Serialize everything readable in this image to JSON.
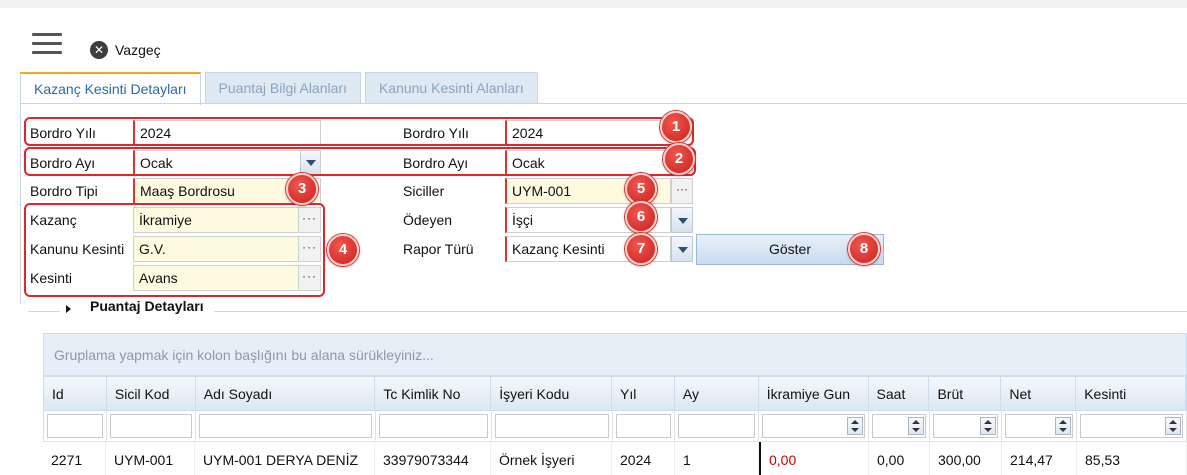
{
  "toolbar": {
    "close_label": "Vazgeç",
    "menu_icon": "hamburger-menu-icon",
    "close_icon": "close-circle-icon"
  },
  "tabs": [
    {
      "label": "Kazanç Kesinti Detayları",
      "active": true
    },
    {
      "label": "Puantaj Bilgi Alanları",
      "active": false
    },
    {
      "label": "Kanunu Kesinti Alanları",
      "active": false
    }
  ],
  "form": {
    "left": {
      "bordro_yili": {
        "label": "Bordro Yılı",
        "value": "2024"
      },
      "bordro_ayi": {
        "label": "Bordro Ayı",
        "value": "Ocak"
      },
      "bordro_tipi": {
        "label": "Bordro Tipi",
        "value": "Maaş Bordrosu"
      },
      "kazanc": {
        "label": "Kazanç",
        "value": "İkramiye"
      },
      "kanunu_kesinti": {
        "label": "Kanunu Kesinti",
        "value": "G.V."
      },
      "kesinti": {
        "label": "Kesinti",
        "value": "Avans"
      }
    },
    "right": {
      "bordro_yili": {
        "label": "Bordro Yılı",
        "value": "2024"
      },
      "bordro_ayi": {
        "label": "Bordro Ayı",
        "value": "Ocak"
      },
      "siciller": {
        "label": "Siciller",
        "value": "UYM-001"
      },
      "odeyen": {
        "label": "Ödeyen",
        "value": "İşçi"
      },
      "rapor_turu": {
        "label": "Rapor Türü",
        "value": "Kazanç Kesinti"
      }
    },
    "show_button": "Göster"
  },
  "badges": [
    "1",
    "2",
    "3",
    "4",
    "5",
    "6",
    "7",
    "8"
  ],
  "section": {
    "title": "Puantaj Detayları"
  },
  "grid": {
    "group_hint": "Gruplama yapmak için kolon başlığını bu alana sürükleyiniz...",
    "columns": [
      "Id",
      "Sicil Kod",
      "Adı Soyadı",
      "Tc Kimlik No",
      "İşyeri Kodu",
      "Yıl",
      "Ay",
      "İkramiye Gun",
      "Saat",
      "Brüt",
      "Net",
      "Kesinti"
    ],
    "rows": [
      [
        "2271",
        "UYM-001",
        "UYM-001 DERYA DENİZ",
        "33979073344",
        "Örnek İşyeri",
        "2024",
        "1",
        "0,00",
        "0,00",
        "300,00",
        "214,47",
        "85,53"
      ]
    ]
  },
  "colors": {
    "highlight_red": "#e3242b",
    "negative_value": "#d00000",
    "tab_accent": "#f5a623"
  }
}
